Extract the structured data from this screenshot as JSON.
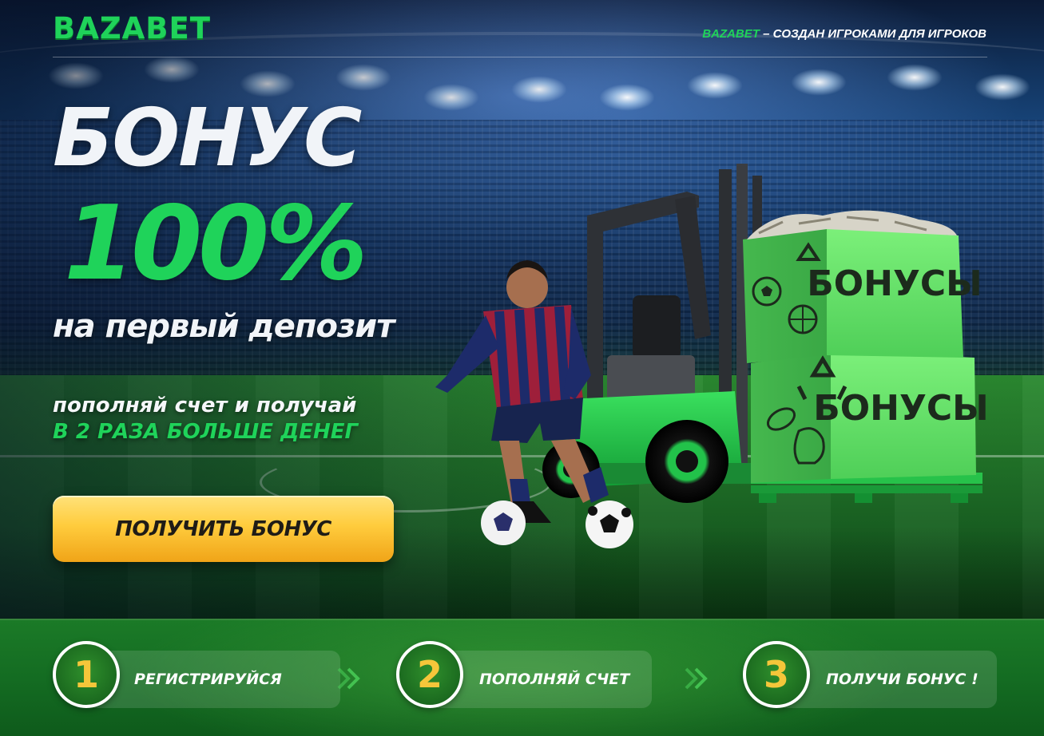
{
  "header": {
    "logo": "BAZABET",
    "tagline_brand": "BAZABET",
    "tagline_rest": " – СОЗДАН ИГРОКАМИ ДЛЯ ИГРОКОВ"
  },
  "hero": {
    "headline_1": "БОНУС",
    "headline_2": "100%",
    "headline_3": "на первый депозит",
    "subline_1": "пополняй счет и получай",
    "subline_2": "В 2 РАЗА БОЛЬШЕ ДЕНЕГ",
    "cta_label": "ПОЛУЧИТЬ БОНУС",
    "box_label_top": "БОНУСЫ",
    "box_label_bottom": "БОНУСЫ"
  },
  "steps": [
    {
      "number": "1",
      "label": "РЕГИСТРИРУЙСЯ"
    },
    {
      "number": "2",
      "label": "ПОПОЛНЯЙ СЧЕТ"
    },
    {
      "number": "3",
      "label": "ПОЛУЧИ БОНУС !"
    }
  ],
  "colors": {
    "brand_green": "#1fd35a",
    "cta_yellow": "#ffcc3d",
    "step_number": "#f5c63a",
    "steps_bar": "#146c22",
    "forklift_green": "#22c24a",
    "box_green": "#6be36a"
  },
  "icons": [
    "soccer-ball-icon",
    "basketball-icon",
    "recycle-icon",
    "rugby-ball-icon",
    "boxing-glove-icon",
    "arrow-chevrons-icon"
  ]
}
